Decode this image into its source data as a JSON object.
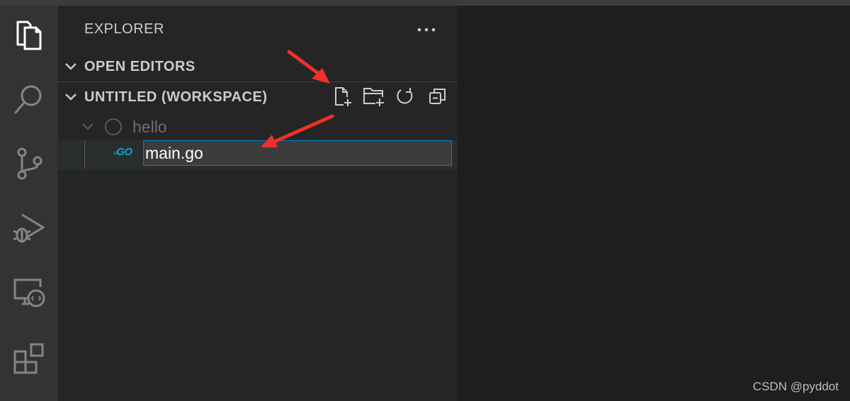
{
  "activity_bar": {
    "items": [
      {
        "name": "explorer",
        "icon": "files-icon",
        "active": true
      },
      {
        "name": "search",
        "icon": "search-icon",
        "active": false
      },
      {
        "name": "source-control",
        "icon": "source-control-icon",
        "active": false
      },
      {
        "name": "run-and-debug",
        "icon": "run-debug-icon",
        "active": false
      },
      {
        "name": "remote-explorer",
        "icon": "remote-explorer-icon",
        "active": false
      },
      {
        "name": "extensions",
        "icon": "extensions-icon",
        "active": false
      }
    ]
  },
  "sidebar": {
    "title": "EXPLORER",
    "more_icon": "ellipsis-icon",
    "sections": {
      "open_editors": {
        "label": "OPEN EDITORS",
        "expanded": false
      },
      "workspace": {
        "label": "UNTITLED (WORKSPACE)",
        "expanded": true,
        "toolbar": [
          "new-file-icon",
          "new-folder-icon",
          "refresh-icon",
          "collapse-all-icon"
        ]
      }
    },
    "tree": {
      "folder": {
        "label": "hello",
        "expanded": true
      },
      "new_file": {
        "icon_text": "GO",
        "icon_name": "go-file-icon",
        "value": "main.go"
      }
    }
  },
  "watermark": "CSDN @pyddot",
  "colors": {
    "accent": "#007fd4",
    "annotation_arrow": "#f0302a",
    "go_icon": "#00add8"
  }
}
